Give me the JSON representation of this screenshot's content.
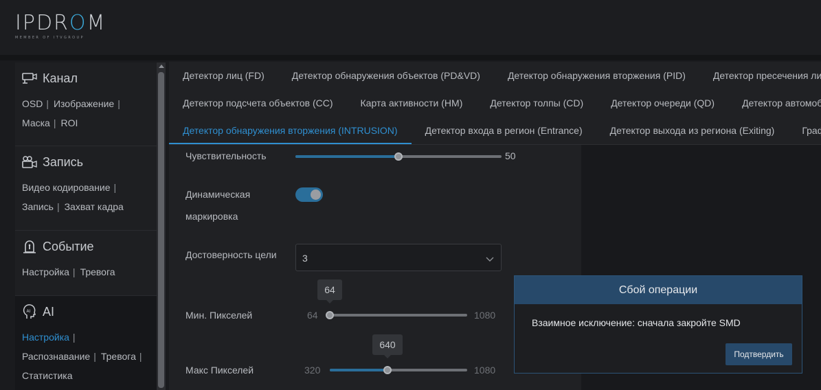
{
  "brand": {
    "name_part1": "IPDR",
    "name_o": "O",
    "name_part2": "M",
    "tagline": "MEMBER OF ITVGROUP"
  },
  "sidebar": {
    "sections": [
      {
        "title": "Канал",
        "icon": "camera-icon",
        "links": [
          "OSD",
          "Изображение",
          "Маска",
          "ROI"
        ]
      },
      {
        "title": "Запись",
        "icon": "video-camera-icon",
        "links": [
          "Видео кодирование",
          "Запись",
          "Захват кадра"
        ]
      },
      {
        "title": "Событие",
        "icon": "alarm-icon",
        "links": [
          "Настройка",
          "Тревога"
        ]
      },
      {
        "title": "AI",
        "icon": "ai-head-icon",
        "links": [
          "Настройка",
          "Распознавание",
          "Тревога",
          "Статистика"
        ]
      }
    ],
    "active_link": "Настройка"
  },
  "tabs": {
    "row1": [
      "Детектор лиц (FD)",
      "Детектор обнаружения объектов (PD&VD)",
      "Детектор обнаружения вторжения (PID)",
      "Детектор пресечения ли"
    ],
    "row2": [
      "Детектор подсчета объектов (CC)",
      "Карта активности (HM)",
      "Детектор толпы (CD)",
      "Детектор очереди (QD)",
      "Детектор автомоб"
    ],
    "row3": [
      "Детектор обнаружения вторжения (INTRUSION)",
      "Детектор входа в регион (Entrance)",
      "Детектор выхода из региона (Exiting)",
      "Граф"
    ],
    "active": "Детектор обнаружения вторжения (INTRUSION)"
  },
  "form": {
    "sensitivity": {
      "label": "Чувствительность",
      "value": "50",
      "fraction": 0.5
    },
    "dynamic_marking": {
      "label_line1": "Динамическая",
      "label_line2": "маркировка",
      "on": true
    },
    "target_confidence": {
      "label": "Достоверность цели",
      "value": "3"
    },
    "min_pixels": {
      "label": "Мин. Пикселей",
      "min": "64",
      "max": "1080",
      "value": "64",
      "fraction": 0.0
    },
    "max_pixels": {
      "label": "Макс Пикселей",
      "min": "320",
      "max": "1080",
      "value": "640",
      "fraction": 0.421
    }
  },
  "modal": {
    "title": "Сбой операции",
    "message": "Взаимное исключение: сначала закройте SMD",
    "confirm": "Подтвердить"
  },
  "colors": {
    "accent": "#2f8fd0",
    "modal_header": "#27496a",
    "bg": "#1a1b1e"
  }
}
